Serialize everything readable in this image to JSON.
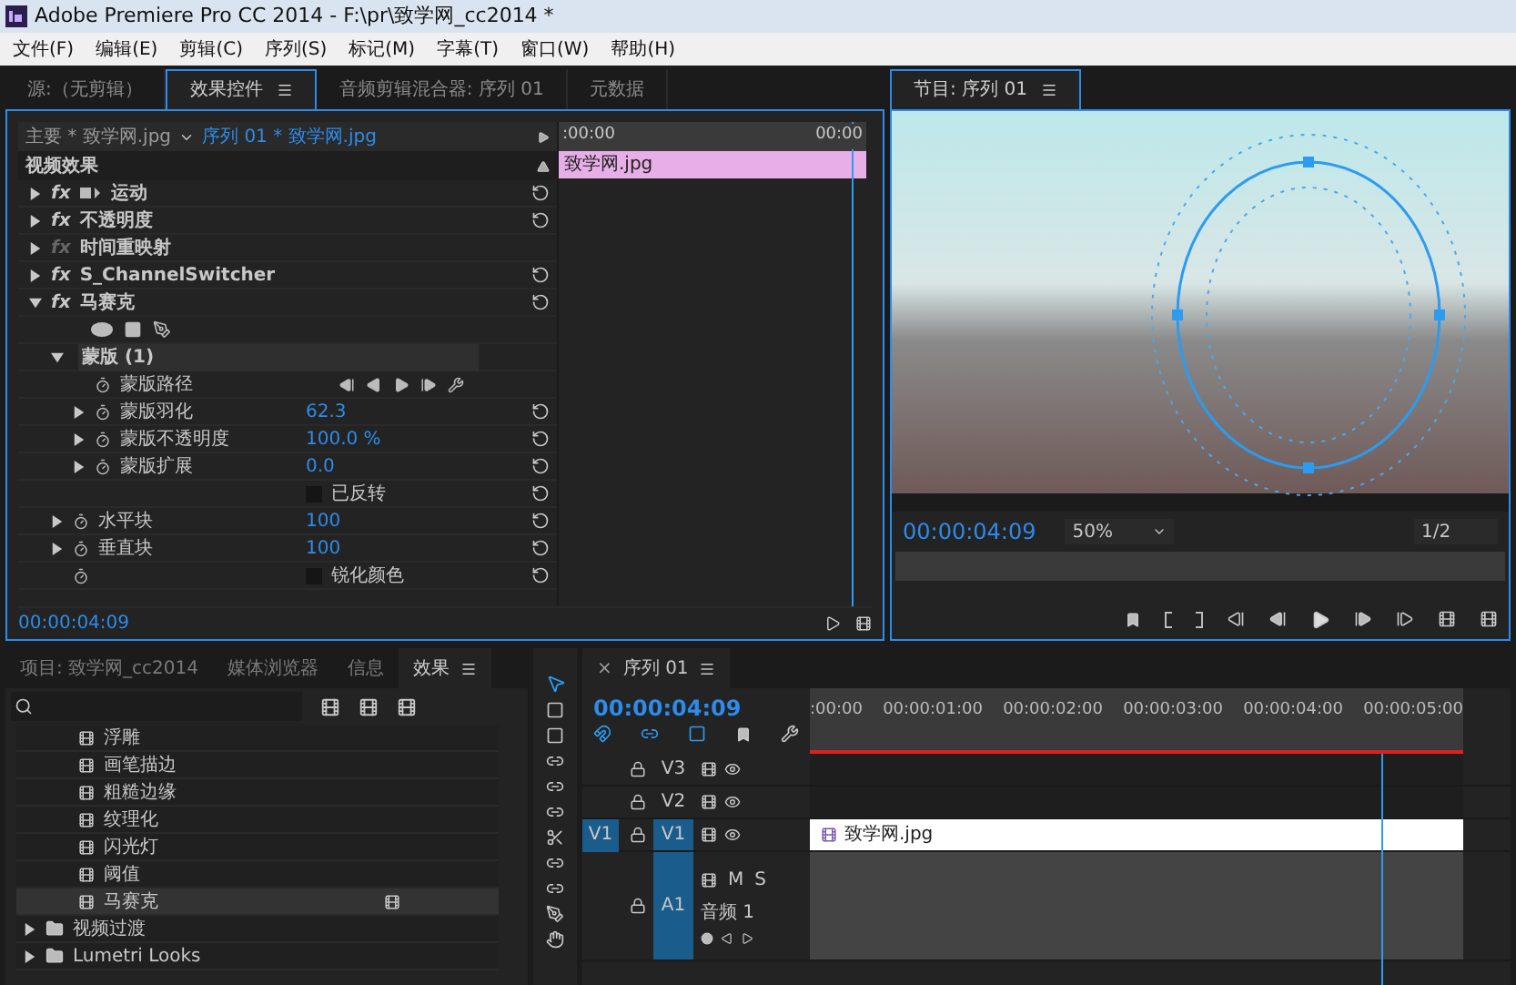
{
  "window": {
    "title": "Adobe Premiere Pro CC 2014 - F:\\pr\\致学网_cc2014 *"
  },
  "menu": [
    "文件(F)",
    "编辑(E)",
    "剪辑(C)",
    "序列(S)",
    "标记(M)",
    "字幕(T)",
    "窗口(W)",
    "帮助(H)"
  ],
  "top_tabs": [
    {
      "label": "源:（无剪辑）",
      "selected": false
    },
    {
      "label": "效果控件",
      "selected": true
    },
    {
      "label": "音频剪辑混合器: 序列 01",
      "selected": false
    },
    {
      "label": "元数据",
      "selected": false
    }
  ],
  "effect_controls": {
    "master": "主要 * 致学网.jpg",
    "sequence_clip": "序列 01 * 致学网.jpg",
    "section": "视频效果",
    "ruler_start": ":00:00",
    "ruler_end": "00:00",
    "clip": "致学网.jpg",
    "playhead": {
      "level": 0.95
    },
    "timecode": "00:00:04:09",
    "rows": [
      {
        "kind": "effect",
        "badge": "fx",
        "name": "运动",
        "fx_on": true,
        "expanded": false,
        "reset": true,
        "transform_icon": true
      },
      {
        "kind": "effect",
        "badge": "fx",
        "name": "不透明度",
        "fx_on": true,
        "expanded": false,
        "reset": true,
        "transform_icon": false
      },
      {
        "kind": "effect",
        "badge": "fx",
        "name": "时间重映射",
        "fx_on": false,
        "expanded": false,
        "reset": false,
        "transform_icon": false
      },
      {
        "kind": "effect",
        "badge": "fx",
        "name": "S_ChannelSwitcher",
        "fx_on": true,
        "expanded": false,
        "reset": true,
        "transform_icon": false
      },
      {
        "kind": "effect",
        "badge": "fx",
        "name": "马赛克",
        "fx_on": true,
        "expanded": true,
        "reset": true,
        "transform_icon": false,
        "children": [
          {
            "kind": "mask_tools"
          },
          {
            "kind": "group",
            "name": "蒙版 (1)",
            "expanded": true,
            "children": [
              {
                "kind": "path",
                "name": "蒙版路径"
              },
              {
                "kind": "param",
                "name": "蒙版羽化",
                "value": "62.3",
                "expanded": false
              },
              {
                "kind": "param",
                "name": "蒙版不透明度",
                "value": "100.0 %",
                "expanded": false
              },
              {
                "kind": "param",
                "name": "蒙版扩展",
                "value": "0.0",
                "expanded": false
              },
              {
                "kind": "checkbox",
                "label": "已反转",
                "checked": false,
                "stopwatch": false
              }
            ]
          },
          {
            "kind": "param",
            "name": "水平块",
            "value": "100",
            "expanded": false
          },
          {
            "kind": "param",
            "name": "垂直块",
            "value": "100",
            "expanded": false
          },
          {
            "kind": "checkbox",
            "label": "锐化颜色",
            "checked": false,
            "stopwatch": true
          }
        ]
      }
    ]
  },
  "program": {
    "tab": "节目: 序列 01",
    "timecode": "00:00:04:09",
    "zoom": "50%",
    "resolution": "1/2"
  },
  "bottom_tabs": [
    {
      "label": "项目: 致学网_cc2014",
      "selected": false
    },
    {
      "label": "媒体浏览器",
      "selected": false
    },
    {
      "label": "信息",
      "selected": false
    },
    {
      "label": "效果",
      "selected": true
    }
  ],
  "effects_list": [
    {
      "kind": "effect",
      "label": "浮雕",
      "selected": false,
      "accelerated": false
    },
    {
      "kind": "effect",
      "label": "画笔描边",
      "selected": false,
      "accelerated": false
    },
    {
      "kind": "effect",
      "label": "粗糙边缘",
      "selected": false,
      "accelerated": false
    },
    {
      "kind": "effect",
      "label": "纹理化",
      "selected": false,
      "accelerated": false
    },
    {
      "kind": "effect",
      "label": "闪光灯",
      "selected": false,
      "accelerated": false
    },
    {
      "kind": "effect",
      "label": "阈值",
      "selected": false,
      "accelerated": false
    },
    {
      "kind": "effect",
      "label": "马赛克",
      "selected": true,
      "accelerated": true
    },
    {
      "kind": "folder",
      "label": "视频过渡",
      "selected": false,
      "expanded": false
    },
    {
      "kind": "folder",
      "label": "Lumetri Looks",
      "selected": false,
      "expanded": false
    }
  ],
  "timeline": {
    "tab": "序列 01",
    "close": "×",
    "timecode": "00:00:04:09",
    "ruler": [
      ":00:00",
      "00:00:01:00",
      "00:00:02:00",
      "00:00:03:00",
      "00:00:04:00",
      "00:00:05:00"
    ],
    "playhead": {
      "level": 0.875
    },
    "tracks": [
      {
        "kind": "video",
        "label": "V3",
        "targeted": false
      },
      {
        "kind": "video",
        "label": "V2",
        "targeted": false
      },
      {
        "kind": "video",
        "source": "V1",
        "label": "V1",
        "targeted": true,
        "clip": "致学网.jpg"
      },
      {
        "kind": "audio",
        "label": "A1",
        "targeted": true,
        "name": "音频 1",
        "mute": "M",
        "solo": "S"
      }
    ]
  }
}
